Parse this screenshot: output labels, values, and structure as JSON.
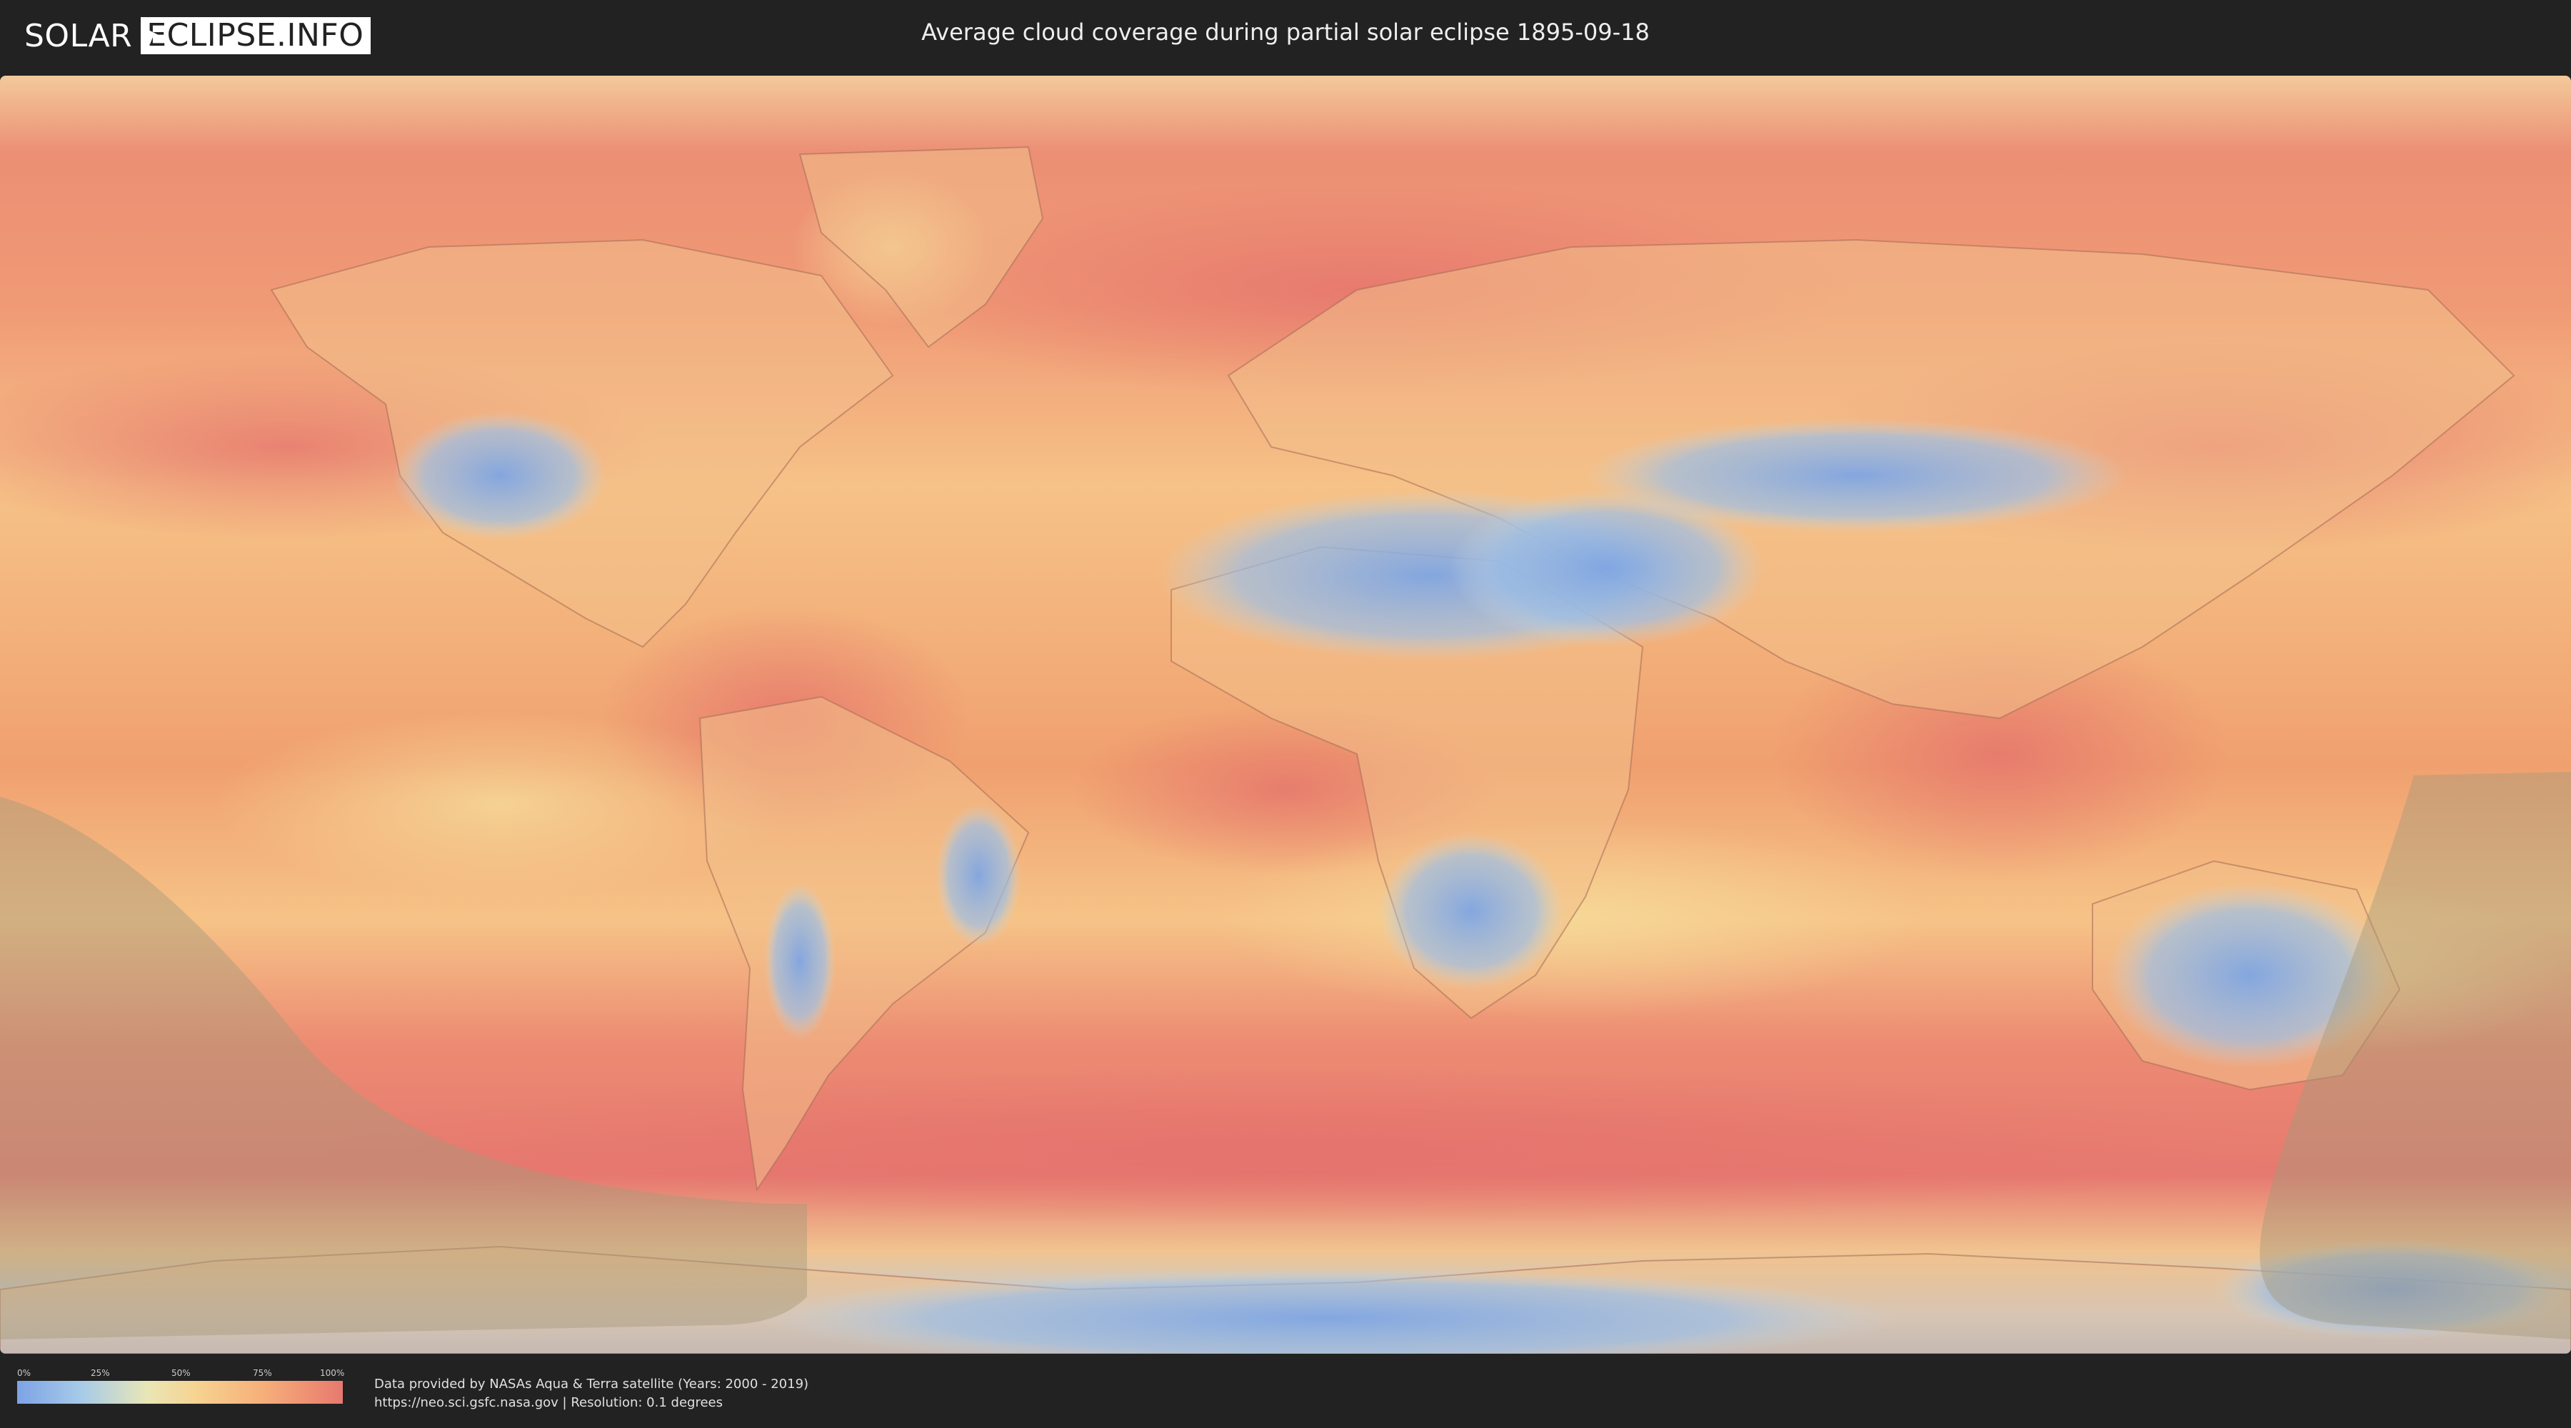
{
  "header": {
    "logo_left": "SOLAR",
    "logo_right": "ECLIPSE.INFO",
    "title": "Average cloud coverage during partial solar eclipse 1895-09-18"
  },
  "map": {
    "colors": {
      "ocean_high": "#e77c70",
      "ocean_mid": "#f4ac79",
      "ocean_low": "#f3d494",
      "desert_clear": "#7ea5e3",
      "ice_light": "#a9ccec",
      "eclipse_shadow": "#a69a7a"
    }
  },
  "legend": {
    "ticks": [
      "0%",
      "25%",
      "50%",
      "75%",
      "100%"
    ]
  },
  "footer": {
    "credit_line1": "Data provided by NASAs Aqua & Terra satellite (Years: 2000 - 2019)",
    "credit_line2": "https://neo.sci.gsfc.nasa.gov | Resolution: 0.1 degrees"
  }
}
